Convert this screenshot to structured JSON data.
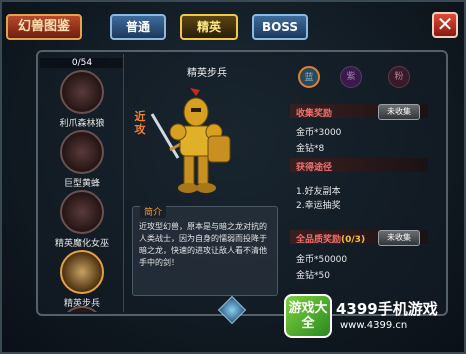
{
  "header": {
    "title": "幻兽图鉴",
    "tabs": [
      {
        "label": "普通"
      },
      {
        "label": "精英"
      },
      {
        "label": "BOSS"
      }
    ],
    "close": "✕"
  },
  "list": {
    "count": "0/54",
    "items": [
      {
        "name": "利爪森林狼"
      },
      {
        "name": "巨型黄蜂"
      },
      {
        "name": "精英魔化女巫"
      },
      {
        "name": "精英步兵"
      }
    ]
  },
  "unit": {
    "name": "精英步兵",
    "role": "近攻",
    "desc_tag": "简介",
    "description": "近攻型幻兽，原本是与暗之龙对抗的人类战士，因为自身的懦弱而投降于暗之龙，快速的进攻让敌人看不清他手中的剑！"
  },
  "orbs": [
    {
      "label": "蓝"
    },
    {
      "label": "紫"
    },
    {
      "label": "粉"
    }
  ],
  "rewards": {
    "collect_label": "收集奖励",
    "collect_btn": "未收集",
    "gold": "金币*3000",
    "diamond": "金钻*8",
    "source_label": "获得途径",
    "source_1": "1.好友副本",
    "source_2": "2.幸运抽奖",
    "full_label": "全品质奖励",
    "full_count": "(0/3)",
    "full_btn": "未收集",
    "full_gold": "金币*50000",
    "full_diamond": "金钻*50"
  },
  "watermark": {
    "logo": "游戏大全",
    "text": "4399手机游戏",
    "url": "www.4399.cn"
  },
  "colors": {
    "accent_gold": "#f2c84a",
    "section_red": "#f07070",
    "tab_blue": "#3d6c9c"
  }
}
